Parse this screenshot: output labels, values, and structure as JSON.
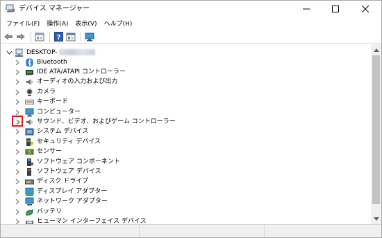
{
  "window": {
    "title": "デバイス マネージャー",
    "icon": "device-manager-icon"
  },
  "menubar": [
    {
      "label": "ファイル(F)"
    },
    {
      "label": "操作(A)"
    },
    {
      "label": "表示(V)"
    },
    {
      "label": "ヘルプ(H)"
    }
  ],
  "toolbar": {
    "buttons": [
      "back-arrow-icon",
      "forward-arrow-icon",
      "properties-icon",
      "help-icon",
      "update-driver-icon",
      "monitor-icon"
    ]
  },
  "tree": {
    "root": "DESKTOP-",
    "items": [
      {
        "label": "Bluetooth",
        "icon": "bluetooth-icon"
      },
      {
        "label": "IDE ATA/ATAPI コントローラー",
        "icon": "ide-controller-icon"
      },
      {
        "label": "オーディオの入力および出力",
        "icon": "speaker-icon"
      },
      {
        "label": "カメラ",
        "icon": "camera-icon"
      },
      {
        "label": "キーボード",
        "icon": "keyboard-icon"
      },
      {
        "label": "コンピューター",
        "icon": "computer-icon"
      },
      {
        "label": "サウンド、ビデオ、およびゲーム コントローラー",
        "icon": "sound-icon",
        "highlighted": true
      },
      {
        "label": "システム デバイス",
        "icon": "system-device-icon"
      },
      {
        "label": "セキュリティ デバイス",
        "icon": "security-device-icon"
      },
      {
        "label": "センサー",
        "icon": "sensor-icon"
      },
      {
        "label": "ソフトウェア コンポーネント",
        "icon": "software-component-icon"
      },
      {
        "label": "ソフトウェア デバイス",
        "icon": "software-device-icon"
      },
      {
        "label": "ディスク ドライブ",
        "icon": "disk-drive-icon"
      },
      {
        "label": "ディスプレイ アダプター",
        "icon": "display-adapter-icon"
      },
      {
        "label": "ネットワーク アダプター",
        "icon": "network-adapter-icon"
      },
      {
        "label": "バッテリ",
        "icon": "battery-icon"
      },
      {
        "label": "ヒューマン インターフェイス デバイス",
        "icon": "hid-icon"
      }
    ]
  },
  "colors": {
    "highlight_border": "#e1141c",
    "expander": "#808080"
  }
}
